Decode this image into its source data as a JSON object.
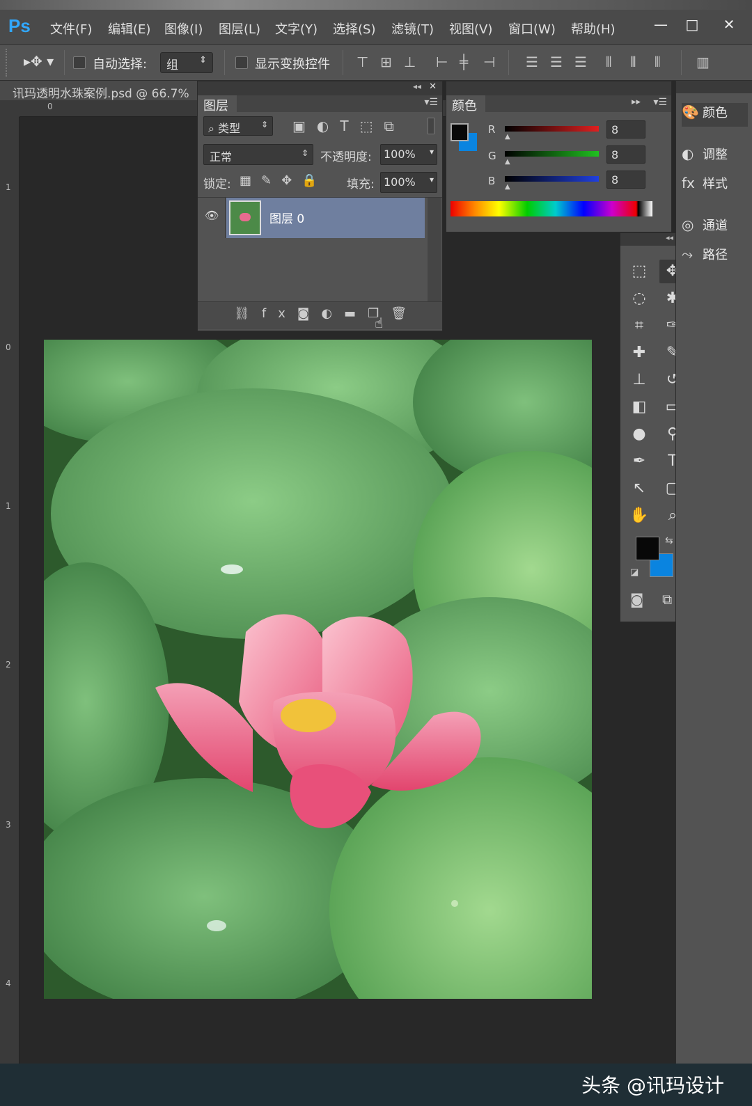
{
  "app": {
    "logo": "Ps"
  },
  "menu": [
    "文件(F)",
    "编辑(E)",
    "图像(I)",
    "图层(L)",
    "文字(Y)",
    "选择(S)",
    "滤镜(T)",
    "视图(V)",
    "窗口(W)",
    "帮助(H)"
  ],
  "window_controls": {
    "minimize": "—",
    "restore": "□",
    "close": "✕"
  },
  "options": {
    "auto_select_label": "自动选择:",
    "auto_select_value": "组",
    "show_transform_label": "显示变换控件"
  },
  "document": {
    "tab_title": "讯玛透明水珠案例.psd @ 66.7%"
  },
  "ruler": {
    "top": [
      "0"
    ],
    "left": [
      "1",
      "0",
      "1",
      "2",
      "3",
      "4"
    ]
  },
  "layers_panel": {
    "tab": "图层",
    "filter_label": "类型",
    "blend_mode": "正常",
    "opacity_label": "不透明度:",
    "opacity_value": "100%",
    "lock_label": "锁定:",
    "fill_label": "填充:",
    "fill_value": "100%",
    "layers": [
      {
        "name": "图层 0",
        "visible": true,
        "selected": true
      }
    ]
  },
  "color_panel": {
    "tab": "颜色",
    "channels": [
      {
        "label": "R",
        "value": "8",
        "color": "#e02020"
      },
      {
        "label": "G",
        "value": "8",
        "color": "#20c020"
      },
      {
        "label": "B",
        "value": "8",
        "color": "#2040e0"
      }
    ],
    "foreground": "#080808",
    "background": "#0a84e0"
  },
  "dock": [
    "颜色",
    "调整",
    "样式",
    "通道",
    "路径"
  ],
  "tools": [
    "marquee-icon",
    "move-icon",
    "lasso-icon",
    "magic-wand-icon",
    "crop-icon",
    "eyedropper-icon",
    "healing-icon",
    "brush-icon",
    "stamp-icon",
    "history-brush-icon",
    "eraser-icon",
    "gradient-icon",
    "blur-icon",
    "dodge-icon",
    "pen-icon",
    "type-icon",
    "path-select-icon",
    "shape-icon",
    "hand-icon",
    "zoom-icon"
  ],
  "watermark": "头条 @讯玛设计"
}
